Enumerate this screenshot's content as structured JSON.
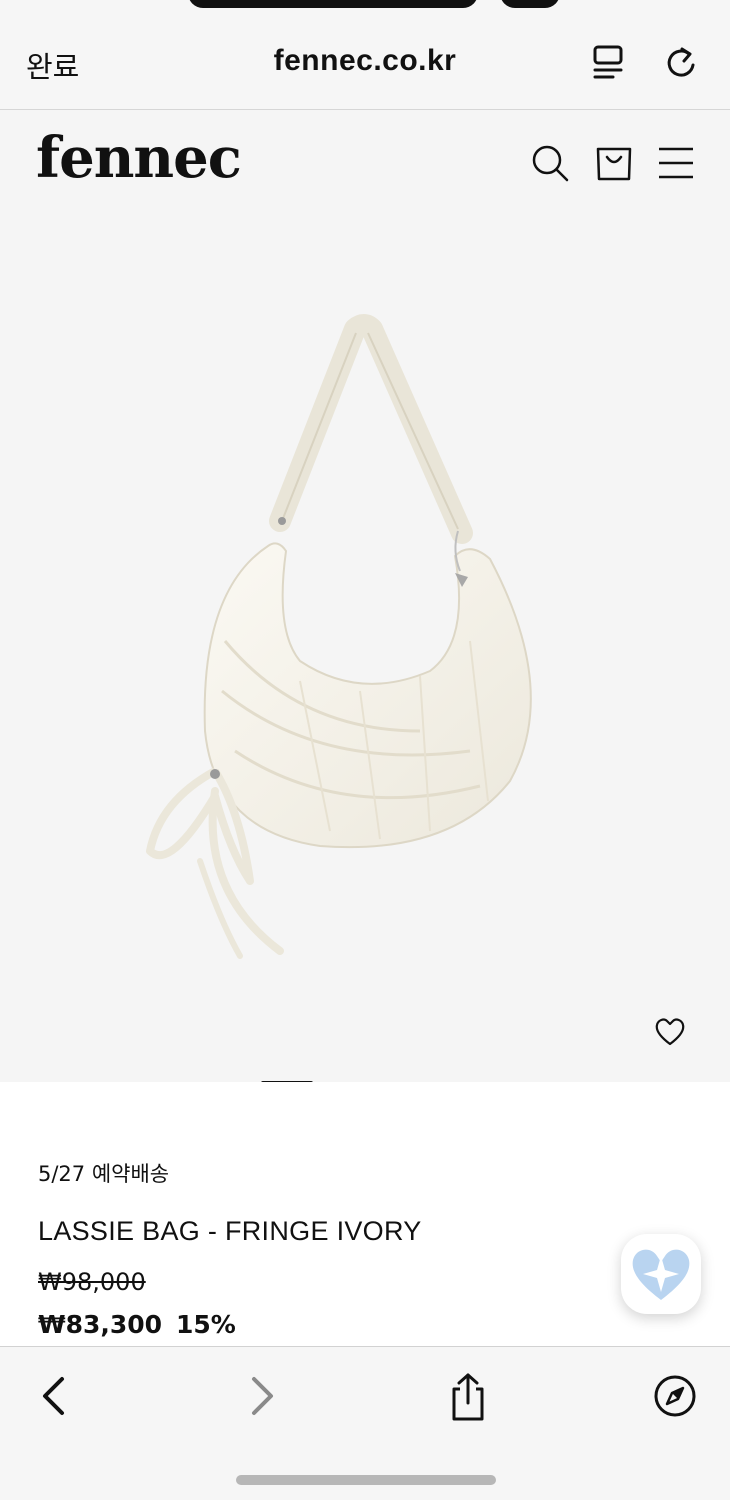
{
  "browser": {
    "done_label": "완료",
    "url": "fennec.co.kr",
    "icons": {
      "reader": "reader-mode-icon",
      "reload": "reload-icon",
      "back": "chevron-left-icon",
      "forward": "chevron-right-icon",
      "share": "share-icon",
      "compass": "compass-icon"
    }
  },
  "site": {
    "logo": "fennec",
    "icons": {
      "search": "search-icon",
      "cart": "shopping-bag-icon",
      "menu": "hamburger-menu-icon",
      "wishlist": "heart-outline-icon",
      "floating_like": "sparkle-heart-icon"
    }
  },
  "product": {
    "delivery_note": "5/27 예약배송",
    "name": "LASSIE BAG - FRINGE IVORY",
    "original_price": "₩98,000",
    "sale_price": "₩83,300",
    "discount": "15%"
  },
  "colors": {
    "background": "#f5f5f5",
    "text": "#111111",
    "like_heart": "#b9d4f0"
  }
}
